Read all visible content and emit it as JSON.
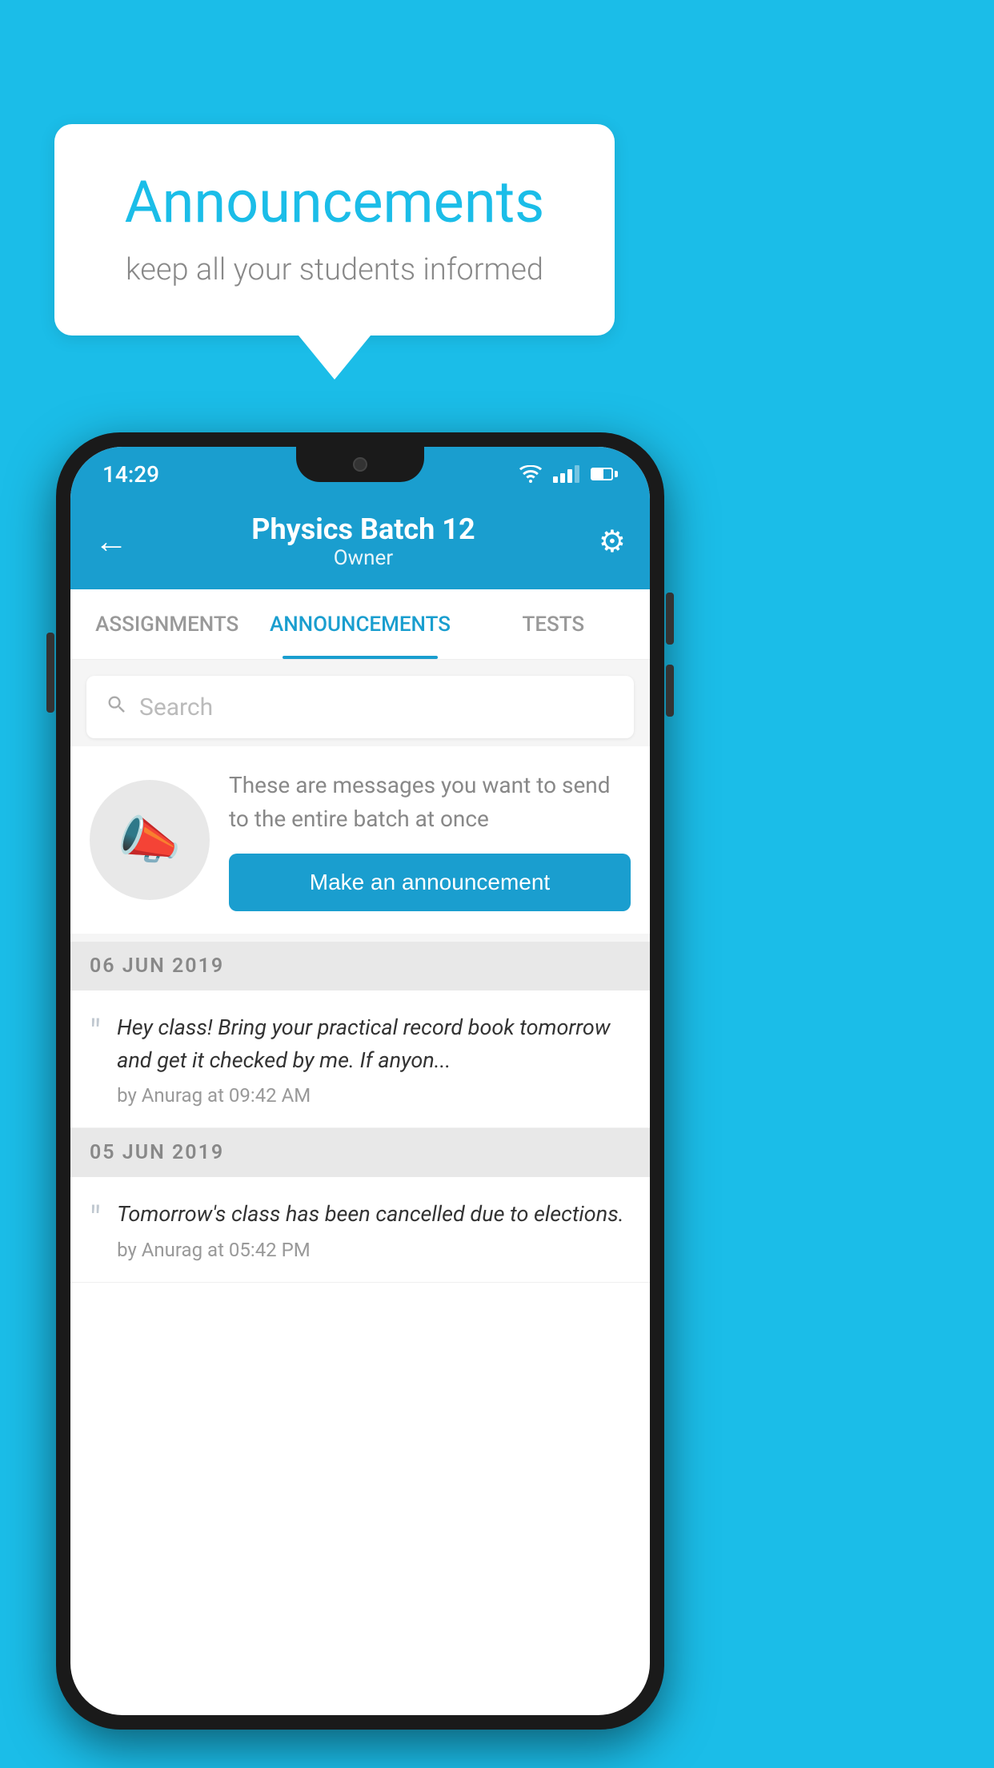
{
  "background_color": "#1BBDE8",
  "speech_bubble": {
    "title": "Announcements",
    "subtitle": "keep all your students informed"
  },
  "phone": {
    "status_bar": {
      "time": "14:29"
    },
    "header": {
      "back_label": "←",
      "title": "Physics Batch 12",
      "subtitle": "Owner",
      "gear_symbol": "⚙"
    },
    "tabs": [
      {
        "label": "ASSIGNMENTS",
        "active": false
      },
      {
        "label": "ANNOUNCEMENTS",
        "active": true
      },
      {
        "label": "TESTS",
        "active": false
      }
    ],
    "search": {
      "placeholder": "Search"
    },
    "promo": {
      "description": "These are messages you want to send to the entire batch at once",
      "button_label": "Make an announcement"
    },
    "announcements": [
      {
        "date": "06  JUN  2019",
        "items": [
          {
            "text": "Hey class! Bring your practical record book tomorrow and get it checked by me. If anyon...",
            "by": "by Anurag at 09:42 AM"
          }
        ]
      },
      {
        "date": "05  JUN  2019",
        "items": [
          {
            "text": "Tomorrow's class has been cancelled due to elections.",
            "by": "by Anurag at 05:42 PM"
          }
        ]
      }
    ]
  }
}
